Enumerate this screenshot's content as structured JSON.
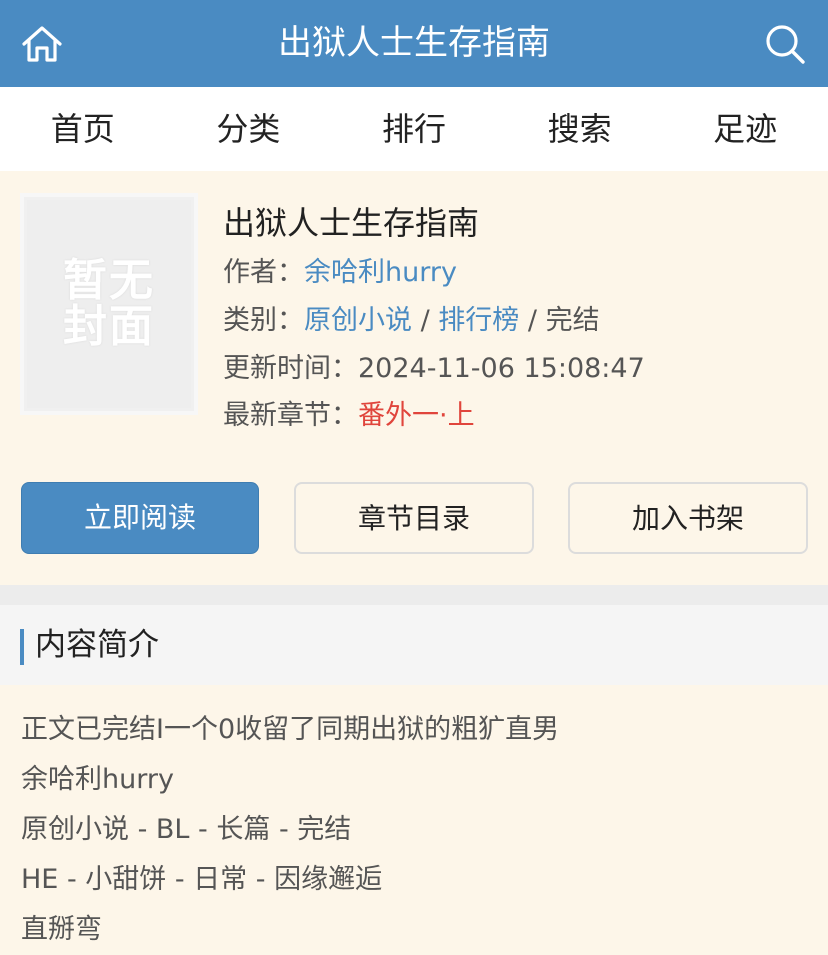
{
  "header": {
    "title": "出狱人士生存指南",
    "home_icon": "home-icon",
    "search_icon": "search-icon"
  },
  "nav": [
    "首页",
    "分类",
    "排行",
    "搜索",
    "足迹"
  ],
  "book": {
    "cover_text": "暂无封面",
    "title": "出狱人士生存指南",
    "author_label": "作者：",
    "author": "余哈利hurry",
    "category_label": "类别：",
    "category": "原创小说",
    "rank": "排行榜",
    "status": "完结",
    "sep": "/",
    "updated_label": "更新时间：",
    "updated": "2024-11-06 15:08:47",
    "latest_label": "最新章节：",
    "latest": "番外一·上"
  },
  "buttons": {
    "read": "立即阅读",
    "toc": "章节目录",
    "shelf": "加入书架"
  },
  "section": {
    "title": "内容简介"
  },
  "intro": [
    "正文已完结I一个0收留了同期出狱的粗犷直男",
    "余哈利hurry",
    "原创小说 - BL - 长篇 - 完结",
    "HE - 小甜饼 - 日常 - 因缘邂逅",
    "直掰弯"
  ],
  "colors": {
    "accent": "#4a8bc2",
    "highlight": "#e0453c",
    "background": "#fdf6e9"
  }
}
